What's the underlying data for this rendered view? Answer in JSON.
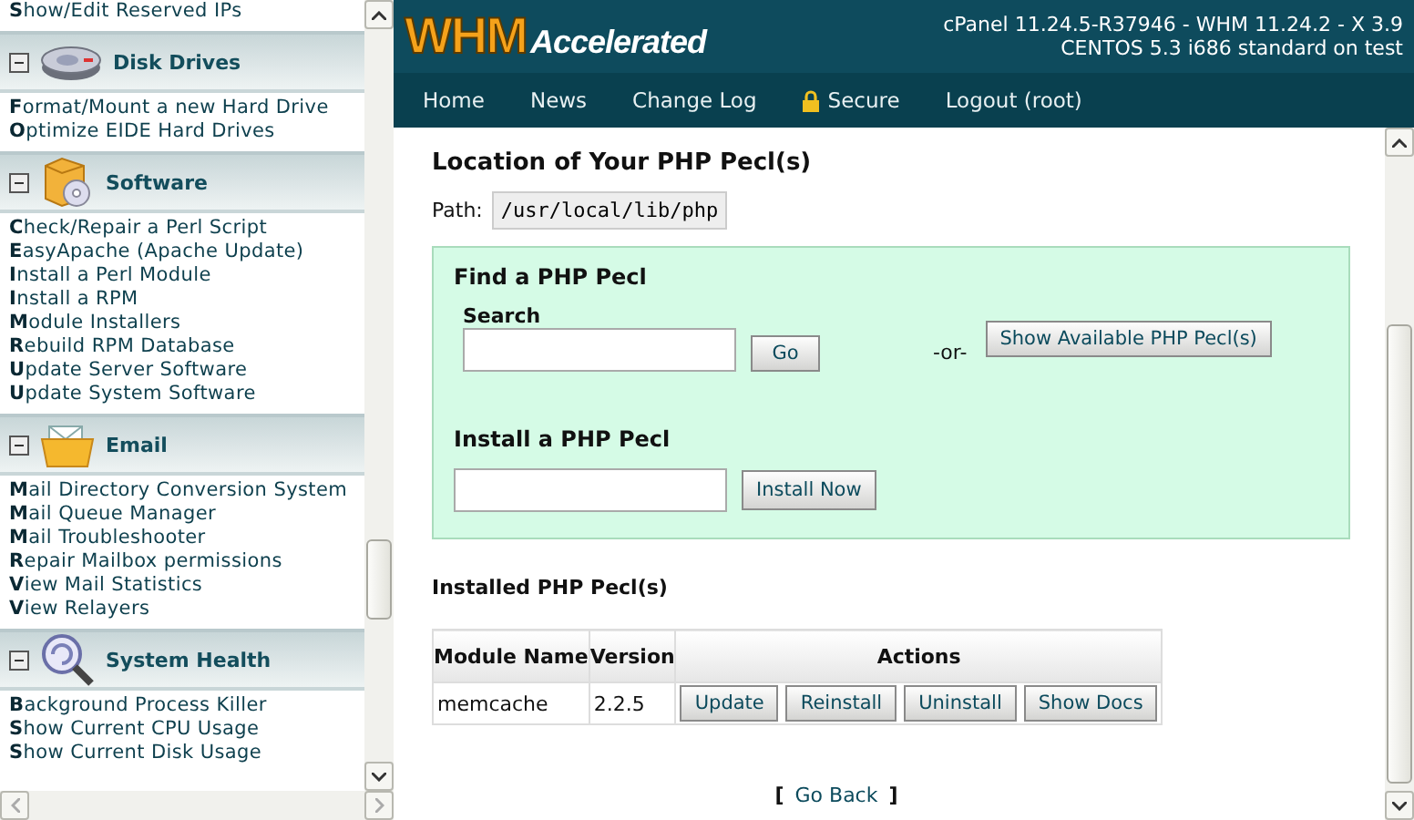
{
  "sidebar": {
    "sections": [
      {
        "items": [
          "**S**how/Edit Reserved IPs"
        ]
      },
      {
        "title": "Disk Drives",
        "expanded": true,
        "items": [
          "**F**ormat/Mount a new Hard Drive",
          "**O**ptimize EIDE Hard Drives"
        ]
      },
      {
        "title": "Software",
        "expanded": true,
        "items": [
          "**C**heck/Repair a Perl Script",
          "**E**asyApache (Apache Update)",
          "**I**nstall a Perl Module",
          "**I**nstall a RPM",
          "**M**odule Installers",
          "**R**ebuild RPM Database",
          "**U**pdate Server Software",
          "**U**pdate System Software"
        ]
      },
      {
        "title": "Email",
        "expanded": true,
        "items": [
          "**M**ail Directory Conversion System",
          "**M**ail Queue Manager",
          "**M**ail Troubleshooter",
          "**R**epair Mailbox permissions",
          "**V**iew Mail Statistics",
          "**V**iew Relayers"
        ]
      },
      {
        "title": "System Health",
        "expanded": true,
        "items": [
          "**B**ackground Process Killer",
          "**S**how Current CPU Usage",
          "**S**how Current Disk Usage"
        ]
      }
    ]
  },
  "header": {
    "logo_mark": "WHM",
    "logo_word": "Accelerated",
    "version_lines": [
      "cPanel 11.24.5-R37946 - WHM 11.24.2 - X 3.9",
      "CENTOS 5.3 i686 standard on test"
    ]
  },
  "nav": [
    {
      "label": "Home",
      "kind": "link"
    },
    {
      "label": "News",
      "kind": "link"
    },
    {
      "label": "Change Log",
      "kind": "link"
    },
    {
      "label": "Secure",
      "kind": "secure"
    },
    {
      "label": "Logout (root)",
      "kind": "link"
    }
  ],
  "location": {
    "title": "Location of Your PHP Pecl(s)",
    "path_label": "Path:",
    "path": "/usr/local/lib/php"
  },
  "find": {
    "title": "Find a PHP Pecl",
    "search_label": "Search",
    "go_button": "Go",
    "or_text": "-or-",
    "show_button": "Show Available PHP Pecl(s)"
  },
  "install": {
    "title": "Install a PHP Pecl",
    "button": "Install Now"
  },
  "installed": {
    "title": "Installed PHP Pecl(s)",
    "columns": [
      "Module Name",
      "Version",
      "Actions"
    ],
    "rows": [
      {
        "module": "memcache",
        "version": "2.2.5",
        "actions": [
          "Update",
          "Reinstall",
          "Uninstall",
          "Show Docs"
        ]
      }
    ]
  },
  "go_back": {
    "open": "[",
    "link": "Go Back",
    "close": "]"
  }
}
